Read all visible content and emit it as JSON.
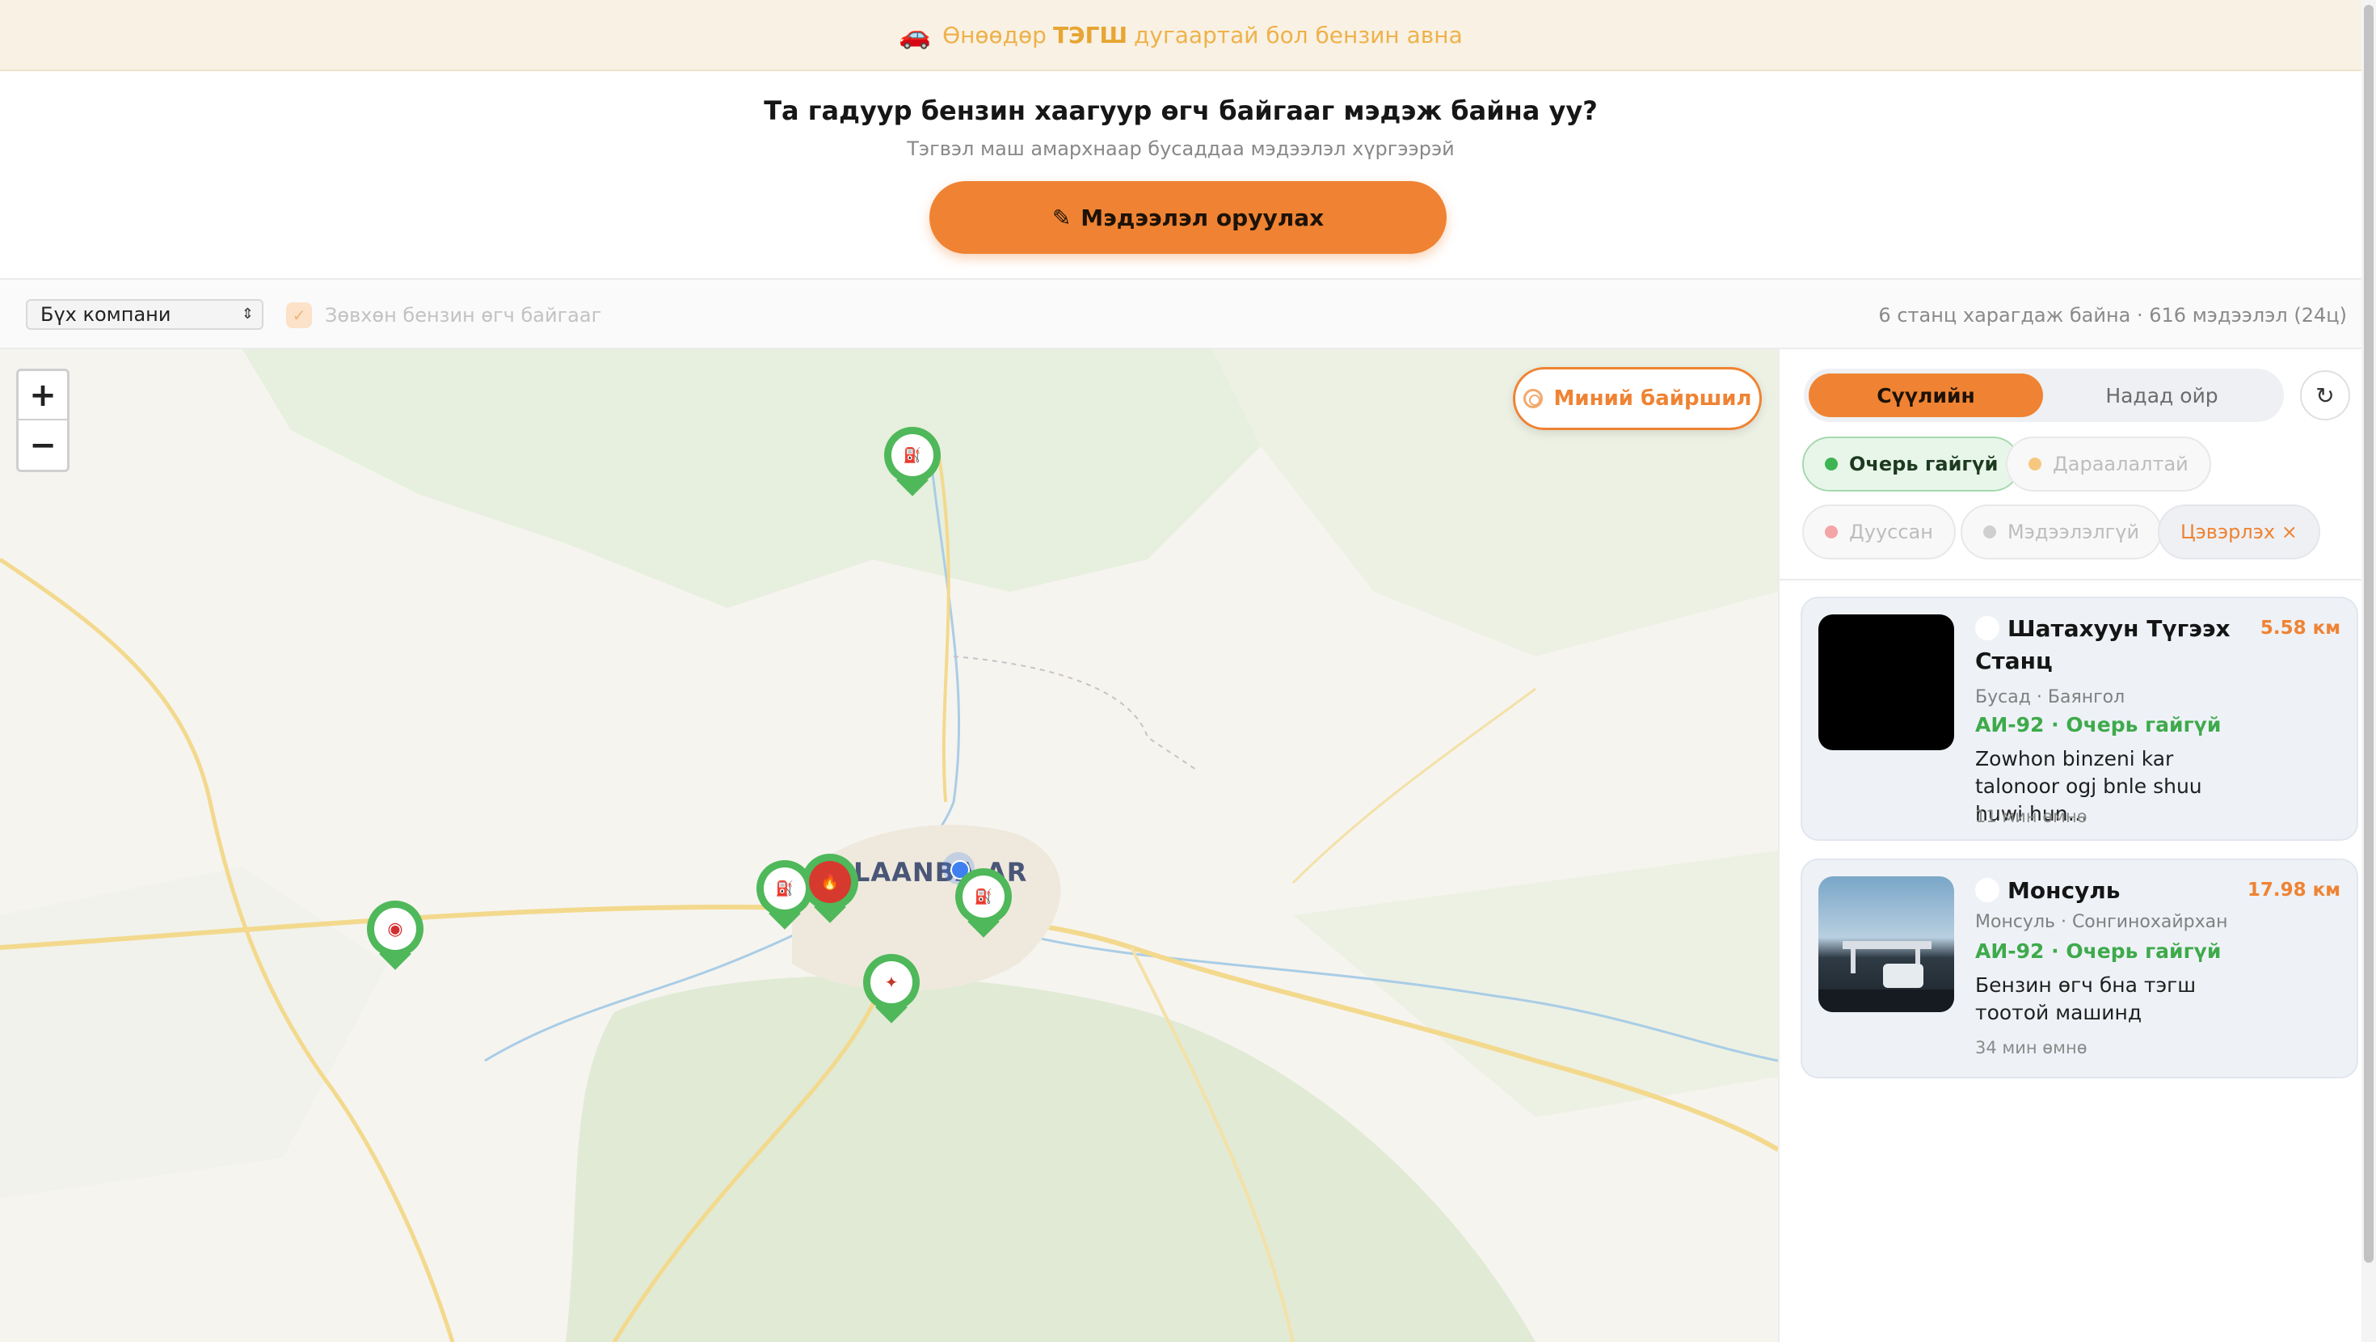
{
  "banner": {
    "icon": "car-icon",
    "prefix": "Өнөөдөр",
    "plate": "ТЭГШ",
    "suffix": "дугаартай бол бензин авна"
  },
  "hero": {
    "title": "Та гадуур бензин хаагуур өгч байгааг мэдэж байна уу?",
    "subtitle": "Тэгвэл маш амархнаар бусаддаа мэдээлэл хүргээрэй",
    "cta_label": "Мэдээлэл оруулах",
    "cta_icon": "✎"
  },
  "filters": {
    "company_select": "Бүх компани",
    "only_giving_label": "Зөвхөн бензин өгч байгааг",
    "stats": "6 станц харагдаж байна · 616 мэдээлэл (24ц)"
  },
  "map": {
    "zoom_in": "+",
    "zoom_out": "−",
    "locate_label": "Миний байршил",
    "city_label": "LAANBA  AR"
  },
  "panel": {
    "sort_tabs": [
      {
        "label": "Сүүлийн",
        "active": true
      },
      {
        "label": "Надад ойр",
        "active": false
      }
    ],
    "refresh_icon": "↻",
    "chips": [
      {
        "label": "Очерь гайгүй",
        "color": "#3eb552",
        "active": true
      },
      {
        "label": "Дараалалтай",
        "color": "#f6c77f",
        "active": false
      },
      {
        "label": "Дууссан",
        "color": "#f4a5a5",
        "active": false
      },
      {
        "label": "Мэдээлэлгүй",
        "color": "#cfcfcf",
        "active": false
      },
      {
        "label": "Цэвэрлэх ×",
        "active": false
      }
    ],
    "cards": [
      {
        "title": "Шатахуун Түгээх Станц",
        "distance": "5.58 км",
        "meta": "Бусад · Баянгол",
        "status": "АИ-92 · Очерь гайгүй",
        "message": "Zowhon binzeni kar talonoor ogj bnle shuu huwi hun…",
        "time": "11 мин өмнө"
      },
      {
        "title": "Монсуль",
        "distance": "17.98 км",
        "meta": "Монсуль · Сонгинохайрхан",
        "status": "АИ-92 · Очерь гайгүй",
        "message": "Бензин өгч бна тэгш тоотой машинд",
        "time": "34 мин өмнө"
      }
    ]
  },
  "colors": {
    "accent": "#ef8333",
    "ok": "#4fb85a",
    "banner_bg": "#f9f1e4"
  }
}
